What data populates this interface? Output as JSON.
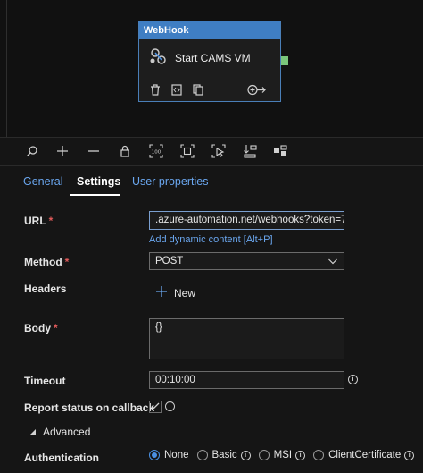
{
  "node": {
    "type_label": "WebHook",
    "title": "Start CAMS VM"
  },
  "toolbar": {
    "icons": [
      "search-icon",
      "add-icon",
      "minus-icon",
      "lock-icon",
      "zoom-100-icon",
      "fit-screen-icon",
      "select-icon",
      "arrange-icon",
      "layout-icon"
    ]
  },
  "tabs": [
    {
      "label": "General"
    },
    {
      "label": "Settings"
    },
    {
      "label": "User properties"
    }
  ],
  "form": {
    "url_label": "URL",
    "url_value": ".azure-automation.net/webhooks?token=7",
    "dynamic_link": "Add dynamic content [Alt+P]",
    "method_label": "Method",
    "method_value": "POST",
    "headers_label": "Headers",
    "new_label": "New",
    "body_label": "Body",
    "body_value": "{}",
    "timeout_label": "Timeout",
    "timeout_value": "00:10:00",
    "report_label": "Report status on callback",
    "report_checked": true,
    "advanced_label": "Advanced",
    "auth_label": "Authentication",
    "auth_options": [
      {
        "label": "None",
        "selected": true
      },
      {
        "label": "Basic",
        "selected": false
      },
      {
        "label": "MSI",
        "selected": false
      },
      {
        "label": "ClientCertificate",
        "selected": false
      }
    ],
    "required_marker": "*"
  },
  "colors": {
    "accent": "#3f7ec3",
    "link": "#6aa6ee",
    "required": "#e05a5a",
    "port": "#7bc67b"
  }
}
